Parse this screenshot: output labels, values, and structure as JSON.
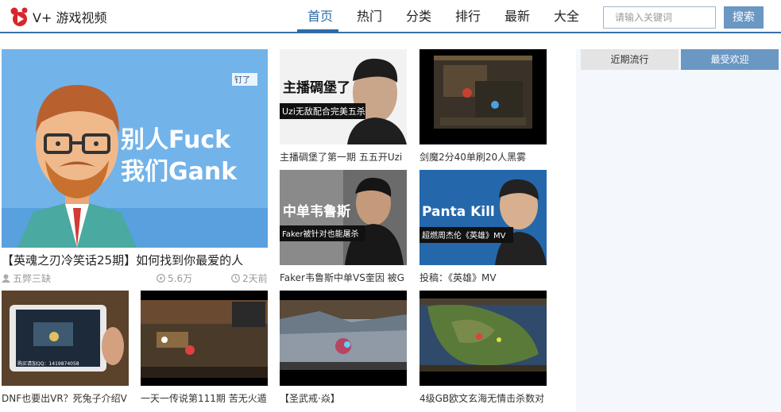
{
  "header": {
    "logo_text": "V+ 游戏视频",
    "nav": [
      {
        "label": "首页",
        "active": true
      },
      {
        "label": "热门",
        "active": false
      },
      {
        "label": "分类",
        "active": false
      },
      {
        "label": "排行",
        "active": false
      },
      {
        "label": "最新",
        "active": false
      },
      {
        "label": "大全",
        "active": false
      }
    ],
    "search_placeholder": "请输入关键词",
    "search_button": "搜索"
  },
  "featured": {
    "thumb_line1": "别人Fuck",
    "thumb_line2": "我们Gank",
    "thumb_logo": "钉了",
    "title": "【英魂之刃冷笑话25期】如何找到你最爱的人",
    "author": "五弊三缺",
    "views": "5.6万",
    "time": "2天前"
  },
  "videos": [
    {
      "caption": "主播碉堡了第一期 五五开Uzi",
      "overlay1": "主播碉堡了",
      "overlay2": "Uzi无敌配合完美五杀"
    },
    {
      "caption": "剑魔2分40单刷20人黑雾",
      "overlay1": "",
      "overlay2": ""
    },
    {
      "caption": "Faker韦鲁斯中单VS奎因 被G",
      "overlay1": "中单韦鲁斯",
      "overlay2": "Faker被针对也能屠杀"
    },
    {
      "caption": "投稿：《英雄》MV",
      "overlay1": "Panta Kill",
      "overlay2": "超燃周杰伦《英雄》MV"
    },
    {
      "caption": "DNF也要出VR？死兔子介绍V",
      "overlay1": "",
      "overlay2": "",
      "small_text": "购买请加QQ：1419874058"
    },
    {
      "caption": "一天一传说第111期 苦无火遁",
      "overlay1": "",
      "overlay2": ""
    },
    {
      "caption": "【圣武戒·焱】",
      "overlay1": "",
      "overlay2": ""
    },
    {
      "caption": "4级GB欧文玄海无情击杀数对",
      "overlay1": "",
      "overlay2": ""
    }
  ],
  "sidebar": {
    "tabs": [
      {
        "label": "近期流行",
        "active": false
      },
      {
        "label": "最受欢迎",
        "active": true
      }
    ]
  },
  "colors": {
    "accent": "#2c6aa8",
    "button": "#6b97c3",
    "panel_bg": "#f4f8fc"
  }
}
